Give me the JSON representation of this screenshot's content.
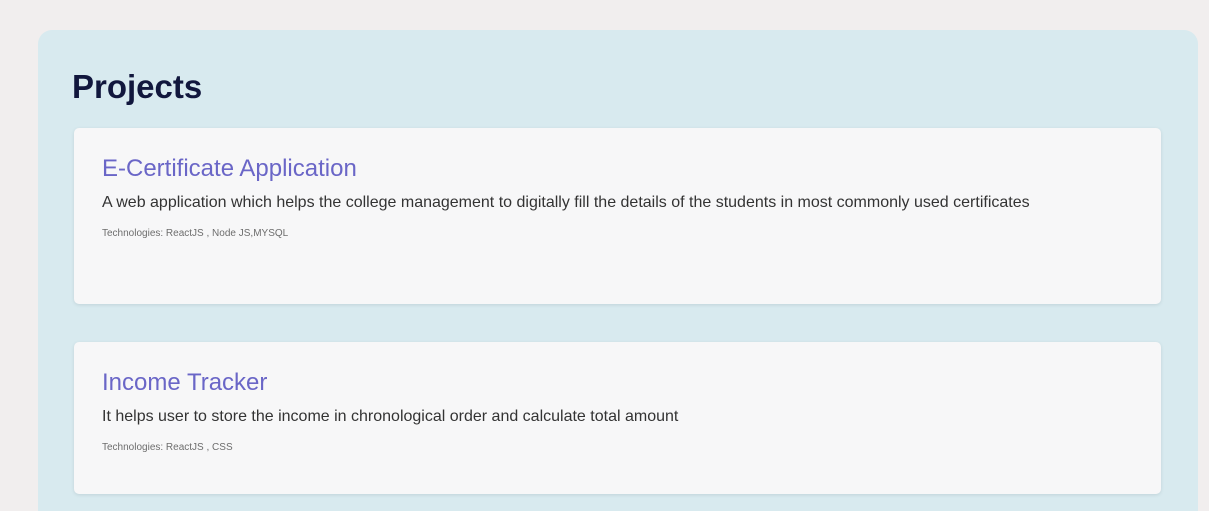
{
  "section": {
    "title": "Projects"
  },
  "projects": [
    {
      "title": "E-Certificate Application",
      "description": "A web application which helps the college management to digitally fill the details of the students in most commonly used certificates",
      "technologies": "Technologies: ReactJS , Node JS,MYSQL"
    },
    {
      "title": "Income Tracker",
      "description": "It helps user to store the income in chronological order and calculate total amount",
      "technologies": "Technologies: ReactJS , CSS"
    }
  ],
  "colors": {
    "page_background": "#f1eeee",
    "section_background": "#d8eaef",
    "card_background": "#f7f7f8",
    "heading": "#11173d",
    "project_title": "#6a66c7",
    "body_text": "#333333",
    "meta_text": "#6d6d6d"
  }
}
